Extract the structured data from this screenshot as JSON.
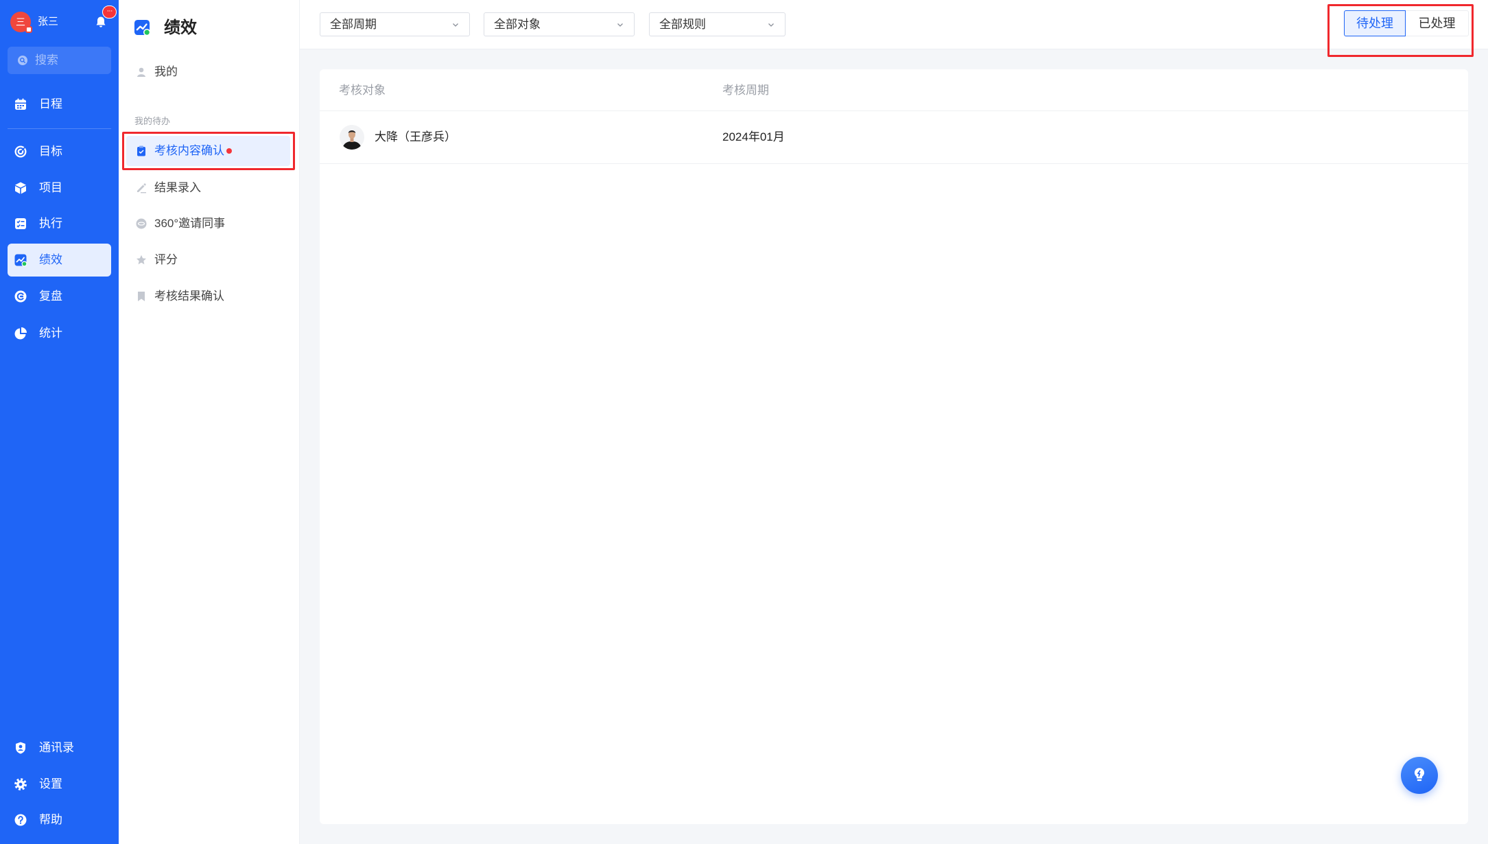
{
  "sidebar": {
    "user": {
      "name": "张三",
      "avatar_text": "三"
    },
    "notification": {
      "icon": "bell-icon",
      "badge": "···"
    },
    "search": {
      "placeholder": "搜索",
      "icon": "search-icon"
    },
    "nav_items": [
      {
        "label": "日程",
        "icon": "calendar-icon"
      },
      {
        "label": "目标",
        "icon": "target-icon"
      },
      {
        "label": "项目",
        "icon": "cube-icon"
      },
      {
        "label": "执行",
        "icon": "checklist-icon"
      },
      {
        "label": "绩效",
        "icon": "performance-icon",
        "active": true
      },
      {
        "label": "复盘",
        "icon": "review-icon"
      },
      {
        "label": "统计",
        "icon": "pie-chart-icon"
      }
    ],
    "bottom_items": [
      {
        "label": "通讯录",
        "icon": "contacts-icon"
      },
      {
        "label": "设置",
        "icon": "gear-icon"
      },
      {
        "label": "帮助",
        "icon": "help-icon"
      }
    ]
  },
  "module_panel": {
    "title": "绩效",
    "icon": "performance-icon",
    "mine": {
      "label": "我的",
      "icon": "user-icon"
    },
    "section_label": "我的待办",
    "items": [
      {
        "label": "考核内容确认",
        "icon": "clipboard-icon",
        "active": true,
        "unread": true
      },
      {
        "label": "结果录入",
        "icon": "edit-icon"
      },
      {
        "label": "360°邀请同事",
        "icon": "360-icon"
      },
      {
        "label": "评分",
        "icon": "star-icon"
      },
      {
        "label": "考核结果确认",
        "icon": "bookmark-icon"
      }
    ]
  },
  "filters": [
    {
      "label": "全部周期"
    },
    {
      "label": "全部对象"
    },
    {
      "label": "全部规则"
    }
  ],
  "status_tabs": [
    {
      "label": "待处理",
      "active": true
    },
    {
      "label": "已处理"
    }
  ],
  "table": {
    "columns": [
      "考核对象",
      "考核周期"
    ],
    "rows": [
      {
        "target": "大降（王彦兵）",
        "period": "2024年01月"
      }
    ]
  },
  "floating_button": {
    "icon": "lightbulb-icon"
  },
  "colors": {
    "primary": "#1f65f6",
    "sidebar_active_bg": "#e6eeff",
    "highlight_box": "#f0282d",
    "unread_dot": "#f5353a",
    "page_bg": "#f4f6f9"
  }
}
